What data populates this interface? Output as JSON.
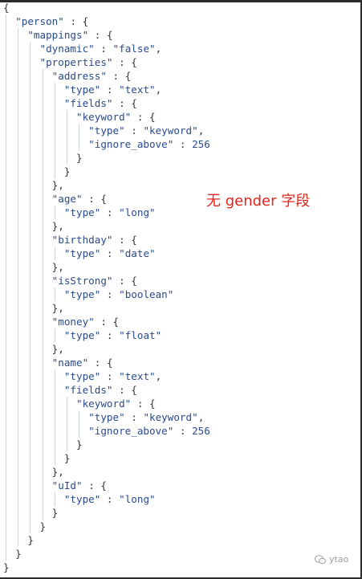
{
  "annotation": "无 gender 字段",
  "watermark": "ytao",
  "lines": [
    "{",
    "  \"person\" : {",
    "    \"mappings\" : {",
    "      \"dynamic\" : \"false\",",
    "      \"properties\" : {",
    "        \"address\" : {",
    "          \"type\" : \"text\",",
    "          \"fields\" : {",
    "            \"keyword\" : {",
    "              \"type\" : \"keyword\",",
    "              \"ignore_above\" : 256",
    "            }",
    "          }",
    "        },",
    "        \"age\" : {",
    "          \"type\" : \"long\"",
    "        },",
    "        \"birthday\" : {",
    "          \"type\" : \"date\"",
    "        },",
    "        \"isStrong\" : {",
    "          \"type\" : \"boolean\"",
    "        },",
    "        \"money\" : {",
    "          \"type\" : \"float\"",
    "        },",
    "        \"name\" : {",
    "          \"type\" : \"text\",",
    "          \"fields\" : {",
    "            \"keyword\" : {",
    "              \"type\" : \"keyword\",",
    "              \"ignore_above\" : 256",
    "            }",
    "          }",
    "        },",
    "        \"uId\" : {",
    "          \"type\" : \"long\"",
    "        }",
    "      }",
    "    }",
    "  }",
    "}"
  ]
}
